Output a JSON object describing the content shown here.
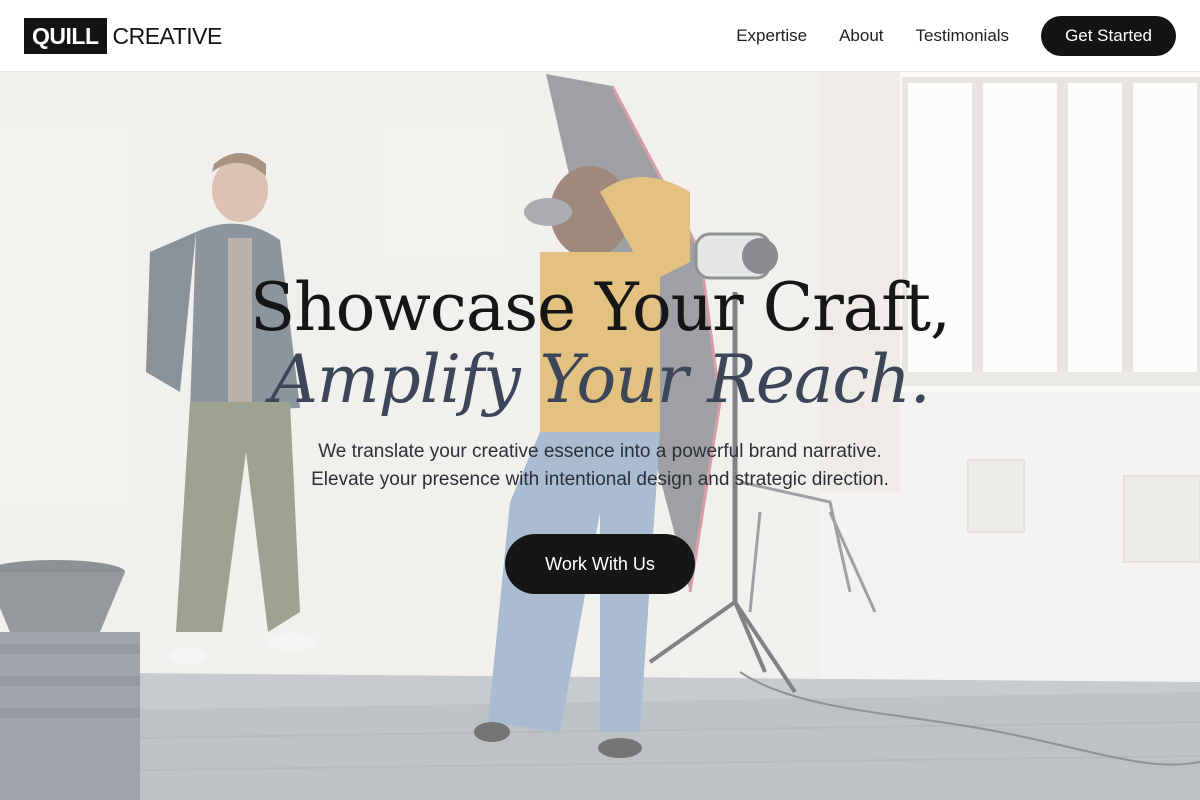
{
  "brand": {
    "mark": "QUILL",
    "word": "CREATIVE"
  },
  "nav": {
    "links": [
      "Expertise",
      "About",
      "Testimonials"
    ],
    "cta_label": "Get Started"
  },
  "hero": {
    "headline_line1": "Showcase Your Craft,",
    "headline_line2": "Amplify Your Reach.",
    "subtext_line1": "We translate your creative essence into a powerful brand narrative.",
    "subtext_line2": "Elevate your presence with intentional design and strategic direction.",
    "cta_label": "Work With Us",
    "background_image": "photo-studio-shoot"
  },
  "colors": {
    "accent": "#141414",
    "headline_dark": "#161616",
    "headline_slate": "#3c4658"
  }
}
